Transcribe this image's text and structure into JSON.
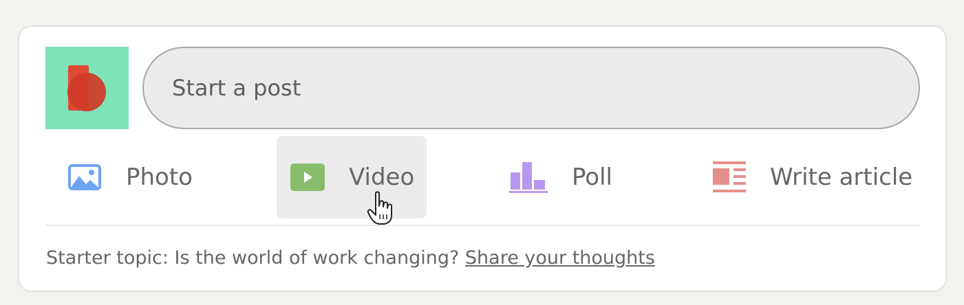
{
  "composer": {
    "avatar_icon": "company-logo-icon",
    "input_placeholder": "Start a post"
  },
  "actions": [
    {
      "label": "Photo",
      "icon": "photo-icon",
      "color": "#6fa3f3"
    },
    {
      "label": "Video",
      "icon": "video-icon",
      "color": "#88bd6c",
      "hovered": true
    },
    {
      "label": "Poll",
      "icon": "poll-icon",
      "color": "#b798ef"
    },
    {
      "label": "Write article",
      "icon": "article-icon",
      "color": "#e48f8c"
    }
  ],
  "starter": {
    "prefix": "Starter topic: Is the world of work changing?",
    "link": "Share your thoughts"
  },
  "colors": {
    "avatar_bg": "#7fe3b8",
    "input_bg": "#ebebeb"
  }
}
